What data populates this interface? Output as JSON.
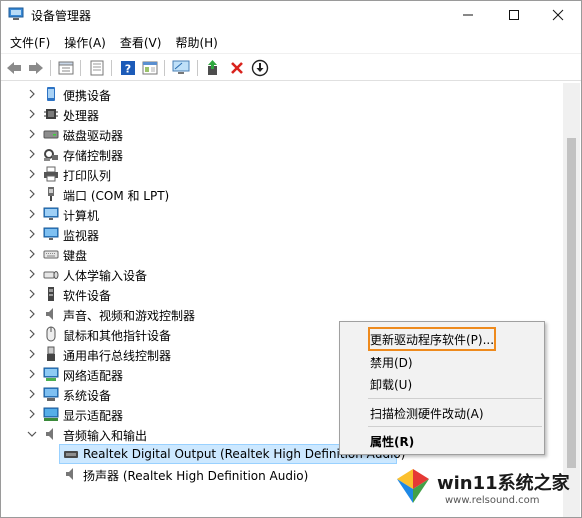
{
  "window": {
    "title": "设备管理器",
    "controls": {
      "minimize": "─",
      "maximize": "☐",
      "close": "✕"
    }
  },
  "menubar": {
    "items": [
      "文件(F)",
      "操作(A)",
      "查看(V)",
      "帮助(H)"
    ]
  },
  "toolbar": {
    "icons": [
      "back-arrow-icon",
      "forward-arrow-icon",
      "properties-view-icon",
      "show-hidden-icon",
      "help-icon",
      "properties-icon",
      "monitor-scan-icon",
      "update-driver-icon",
      "uninstall-x-icon",
      "download-disable-icon"
    ]
  },
  "tree": {
    "items": [
      {
        "label": "便携设备",
        "icon": "portable-device-icon"
      },
      {
        "label": "处理器",
        "icon": "processor-icon"
      },
      {
        "label": "磁盘驱动器",
        "icon": "disk-drive-icon"
      },
      {
        "label": "存储控制器",
        "icon": "storage-controller-icon"
      },
      {
        "label": "打印队列",
        "icon": "printer-icon"
      },
      {
        "label": "端口 (COM 和 LPT)",
        "icon": "port-icon"
      },
      {
        "label": "计算机",
        "icon": "computer-icon"
      },
      {
        "label": "监视器",
        "icon": "monitor-icon"
      },
      {
        "label": "键盘",
        "icon": "keyboard-icon"
      },
      {
        "label": "人体学输入设备",
        "icon": "hid-icon"
      },
      {
        "label": "软件设备",
        "icon": "software-device-icon"
      },
      {
        "label": "声音、视频和游戏控制器",
        "icon": "sound-icon"
      },
      {
        "label": "鼠标和其他指针设备",
        "icon": "mouse-icon"
      },
      {
        "label": "通用串行总线控制器",
        "icon": "usb-icon"
      },
      {
        "label": "网络适配器",
        "icon": "network-adapter-icon"
      },
      {
        "label": "系统设备",
        "icon": "system-device-icon"
      },
      {
        "label": "显示适配器",
        "icon": "display-adapter-icon"
      },
      {
        "label": "音频输入和输出",
        "icon": "audio-io-icon",
        "expanded": true
      }
    ],
    "children": [
      {
        "label": "Realtek Digital Output (Realtek High Definition Audio)",
        "icon": "digital-output-icon",
        "selected": true
      },
      {
        "label": "扬声器 (Realtek High Definition Audio)",
        "icon": "speaker-icon"
      }
    ]
  },
  "context_menu": {
    "items": [
      {
        "label": "更新驱动程序软件(P)...",
        "highlighted": true
      },
      {
        "label": "禁用(D)"
      },
      {
        "label": "卸载(U)"
      },
      {
        "label": "扫描检测硬件改动(A)"
      },
      {
        "label": "属性(R)",
        "bold": true
      }
    ]
  },
  "watermark": {
    "text": "win11系统之家",
    "url": "www.relsound.com"
  },
  "colors": {
    "selection_bg": "#cce8ff",
    "highlight_border": "#ee8a1d",
    "delete_red": "#d9231d",
    "help_blue": "#1c5bb8"
  }
}
